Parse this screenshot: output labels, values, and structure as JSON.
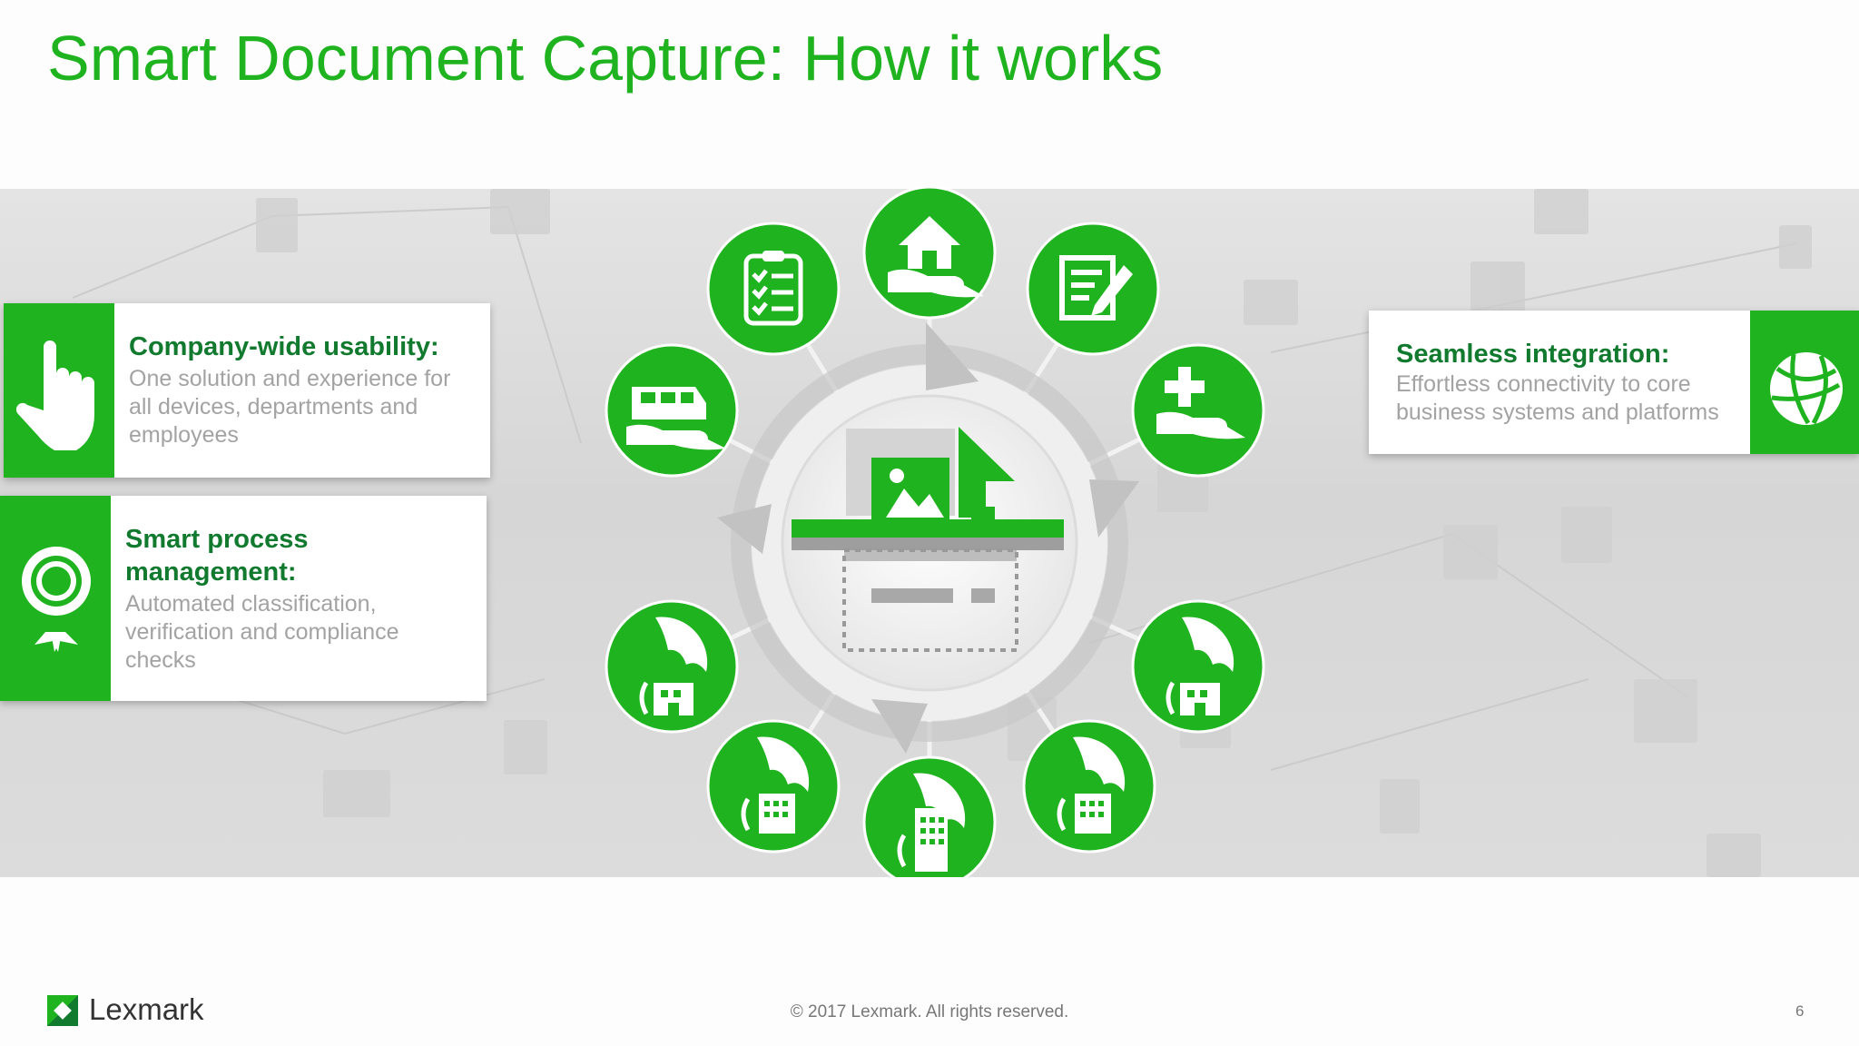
{
  "slide": {
    "title": "Smart Document Capture: How it works",
    "page_number": "6"
  },
  "cards": {
    "usability": {
      "heading": "Company-wide usability:",
      "lines": [
        "One solution and experience for",
        "all devices, departments and",
        "employees"
      ]
    },
    "process": {
      "heading_lines": [
        "Smart process",
        "management:"
      ],
      "lines": [
        "Automated classification,",
        "verification and compliance",
        "checks"
      ]
    },
    "integration": {
      "heading": "Seamless integration:",
      "lines": [
        "Effortless connectivity to core",
        "business systems and platforms"
      ]
    }
  },
  "ring_icons": [
    "home-in-hand-icon",
    "checklist-icon",
    "edit-document-icon",
    "van-in-hand-icon",
    "medical-cross-in-hand-icon",
    "umbrella-building-icon",
    "umbrella-building-icon",
    "umbrella-building-icon",
    "umbrella-building-icon",
    "umbrella-building-icon"
  ],
  "footer": {
    "brand": "Lexmark",
    "copyright": "© 2017 Lexmark. All rights reserved."
  },
  "colors": {
    "accent": "#1fb31f",
    "heading": "#117a2e",
    "body_text": "#a3a3a3"
  }
}
